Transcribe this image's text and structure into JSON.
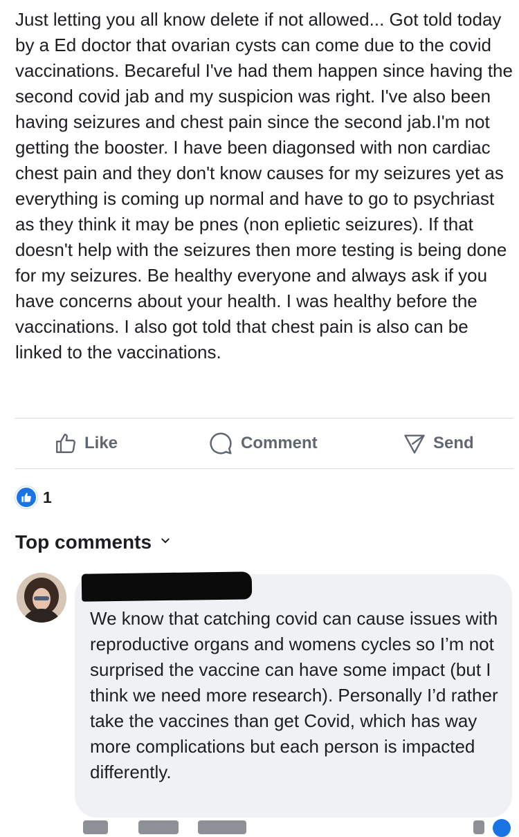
{
  "post": {
    "text": "Just letting you all know delete if not allowed... Got told today by a Ed doctor that ovarian cysts can come due to the covid vaccinations. Becareful I've had them happen since having the second covid jab and my suspicion was right. I've also been having seizures and chest pain since the second jab.I'm not getting the booster. I have been diagonsed with non cardiac chest pain and they don't know causes for my seizures yet as everything is coming up normal and have to go to psychriast as they think it may be pnes (non eplietic seizures). If that doesn't help with the seizures then more testing is being done for my seizures. Be healthy everyone and always ask if you have concerns about your health. I was healthy before the vaccinations. I also got told that chest pain is also can be linked to the vaccinations."
  },
  "actions": {
    "like": {
      "label": "Like",
      "icon": "thumbs-up-outline-icon"
    },
    "comment": {
      "label": "Comment",
      "icon": "speech-bubble-outline-icon"
    },
    "send": {
      "label": "Send",
      "icon": "send-outline-icon"
    }
  },
  "reactions": {
    "icon": "like-reaction-icon",
    "count": "1"
  },
  "comments_section": {
    "sort_label": "Top comments",
    "sort_icon": "chevron-down-icon"
  },
  "comment": {
    "author_redacted": true,
    "text": "We know that catching covid can cause issues with reproductive organs and womens cycles so I’m not surprised the vaccine can have some impact (but I think we need more research). Personally I’d rather take the vaccines than get Covid, which has way more complications but each person is impacted differently."
  },
  "colors": {
    "text": "#1c1e21",
    "secondary_text": "#606770",
    "divider": "#d8dadf",
    "comment_bubble": "#eff1f5",
    "brand_blue": "#1b74e4"
  }
}
